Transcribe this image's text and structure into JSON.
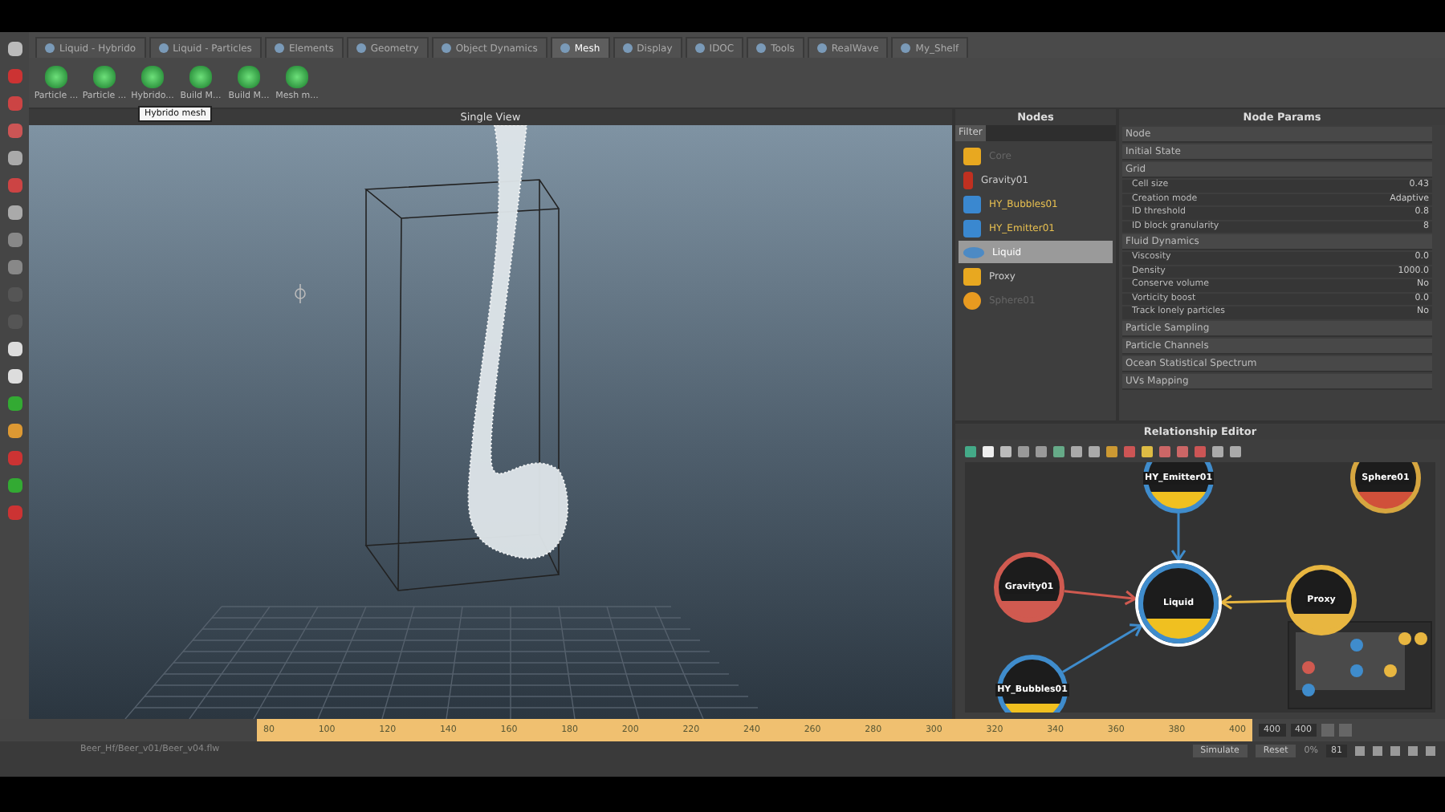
{
  "tabs": [
    {
      "label": "Liquid - Hybrido",
      "selected": false
    },
    {
      "label": "Liquid - Particles",
      "selected": false
    },
    {
      "label": "Elements",
      "selected": false
    },
    {
      "label": "Geometry",
      "selected": false
    },
    {
      "label": "Object Dynamics",
      "selected": false
    },
    {
      "label": "Mesh",
      "selected": true
    },
    {
      "label": "Display",
      "selected": false
    },
    {
      "label": "IDOC",
      "selected": false
    },
    {
      "label": "Tools",
      "selected": false
    },
    {
      "label": "RealWave",
      "selected": false
    },
    {
      "label": "My_Shelf",
      "selected": false
    }
  ],
  "shelf": {
    "buttons": [
      {
        "label": "Particle ..."
      },
      {
        "label": "Particle ..."
      },
      {
        "label": "Hybrido..."
      },
      {
        "label": "Build M..."
      },
      {
        "label": "Build M..."
      },
      {
        "label": "Mesh m..."
      }
    ],
    "tooltip": "Hybrido mesh"
  },
  "viewport": {
    "title": "Single View"
  },
  "nodes_panel": {
    "title": "Nodes",
    "filter_label": "Filter",
    "items": [
      {
        "label": "Core",
        "kind": "cube",
        "disabled": true,
        "selected": false
      },
      {
        "label": "Gravity01",
        "kind": "gravity",
        "disabled": false,
        "selected": false
      },
      {
        "label": "HY_Bubbles01",
        "kind": "bubbles",
        "disabled": false,
        "selected": false
      },
      {
        "label": "HY_Emitter01",
        "kind": "emitter",
        "disabled": false,
        "selected": false
      },
      {
        "label": "Liquid",
        "kind": "liquid",
        "disabled": false,
        "selected": true
      },
      {
        "label": "Proxy",
        "kind": "cube",
        "disabled": false,
        "selected": false
      },
      {
        "label": "Sphere01",
        "kind": "sphere",
        "disabled": true,
        "selected": false
      }
    ]
  },
  "params_panel": {
    "title": "Node Params",
    "rows": [
      {
        "kind": "section",
        "label": "Node"
      },
      {
        "kind": "section",
        "label": "Initial State"
      },
      {
        "kind": "section",
        "label": "Grid"
      },
      {
        "kind": "param",
        "label": "Cell size",
        "value": "0.43"
      },
      {
        "kind": "param",
        "label": "Creation mode",
        "value": "Adaptive"
      },
      {
        "kind": "param",
        "label": "ID threshold",
        "value": "0.8"
      },
      {
        "kind": "param",
        "label": "ID block granularity",
        "value": "8"
      },
      {
        "kind": "section",
        "label": "Fluid Dynamics"
      },
      {
        "kind": "param",
        "label": "Viscosity",
        "value": "0.0"
      },
      {
        "kind": "param",
        "label": "Density",
        "value": "1000.0"
      },
      {
        "kind": "param",
        "label": "Conserve volume",
        "value": "No"
      },
      {
        "kind": "param",
        "label": "Vorticity boost",
        "value": "0.0"
      },
      {
        "kind": "param",
        "label": "Track lonely particles",
        "value": "No"
      },
      {
        "kind": "section",
        "label": "Particle Sampling"
      },
      {
        "kind": "section",
        "label": "Particle Channels"
      },
      {
        "kind": "section",
        "label": "Ocean Statistical Spectrum"
      },
      {
        "kind": "section",
        "label": "UVs Mapping"
      }
    ]
  },
  "relationship_editor": {
    "title": "Relationship Editor",
    "nodes": [
      {
        "label": "HY_Emitter01",
        "kind": "emitter",
        "color": "#3f8ccc",
        "selected": false
      },
      {
        "label": "Sphere01",
        "kind": "sphere",
        "color": "#d6a640",
        "selected": false
      },
      {
        "label": "Gravity01",
        "kind": "gravity",
        "color": "#d05a50",
        "selected": false
      },
      {
        "label": "Liquid",
        "kind": "liquid",
        "color": "#3f8ccc",
        "selected": true
      },
      {
        "label": "Proxy",
        "kind": "proxy",
        "color": "#e8b640",
        "selected": false
      },
      {
        "label": "HY_Bubbles01",
        "kind": "bubbles",
        "color": "#3f8ccc",
        "selected": false
      }
    ]
  },
  "timeline": {
    "ticks": [
      "80",
      "100",
      "120",
      "140",
      "160",
      "180",
      "200",
      "220",
      "240",
      "260",
      "280",
      "300",
      "320",
      "340",
      "360",
      "380",
      "400"
    ],
    "end_fields": [
      "400",
      "400"
    ]
  },
  "controls": {
    "simulate": "Simulate",
    "reset": "Reset",
    "progress": "0%",
    "frame": "81"
  },
  "status": {
    "path": "Beer_Hf/Beer_v01/Beer_v04.flw"
  }
}
